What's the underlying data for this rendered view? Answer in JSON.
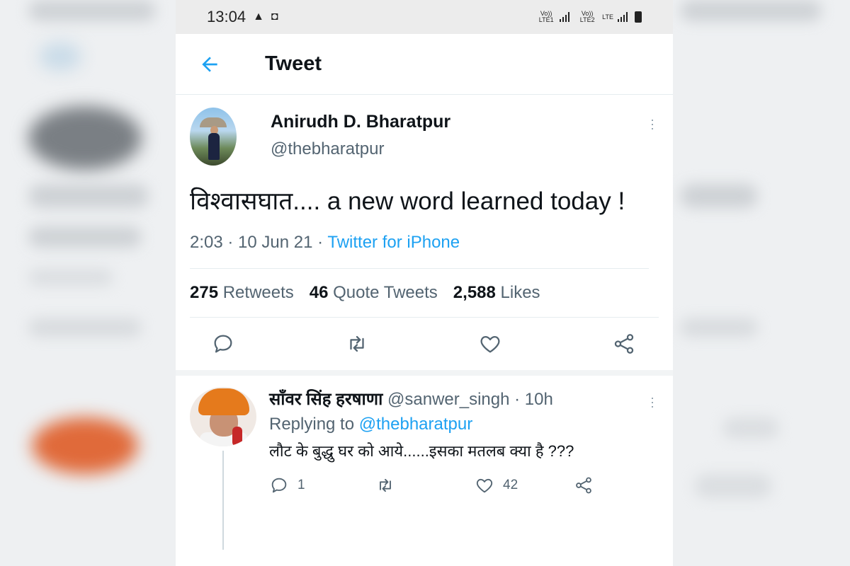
{
  "status_bar": {
    "time": "13:04",
    "warning_icon": "warning-triangle-icon",
    "notification_icon": "screen-icon",
    "sim1": "Vo)) LTE1",
    "sim2": "Vo)) LTE2",
    "lte_label": "LTE"
  },
  "header": {
    "title": "Tweet",
    "back_icon": "back-arrow-icon"
  },
  "tweet": {
    "author_name": "Anirudh D. Bharatpur",
    "author_handle": "@thebharatpur",
    "text": "विश्वासघात.... a new word learned today !",
    "time": "2:03",
    "date": "10 Jun 21",
    "source": "Twitter for iPhone",
    "retweets_count": "275",
    "retweets_label": "Retweets",
    "quotes_count": "46",
    "quotes_label": "Quote Tweets",
    "likes_count": "2,588",
    "likes_label": "Likes"
  },
  "reply": {
    "author_name": "साँवर सिंह हरषाणा",
    "author_handle": "@sanwer_singh",
    "age": "10h",
    "replying_prefix": "Replying to",
    "replying_handle": "@thebharatpur",
    "text": "लौट के बुद्धु घर को आये......इसका मतलब क्या है ???",
    "reply_count": "1",
    "like_count": "42"
  },
  "colors": {
    "accent": "#1da1f2",
    "text_primary": "#0f1419",
    "text_secondary": "#536471"
  }
}
